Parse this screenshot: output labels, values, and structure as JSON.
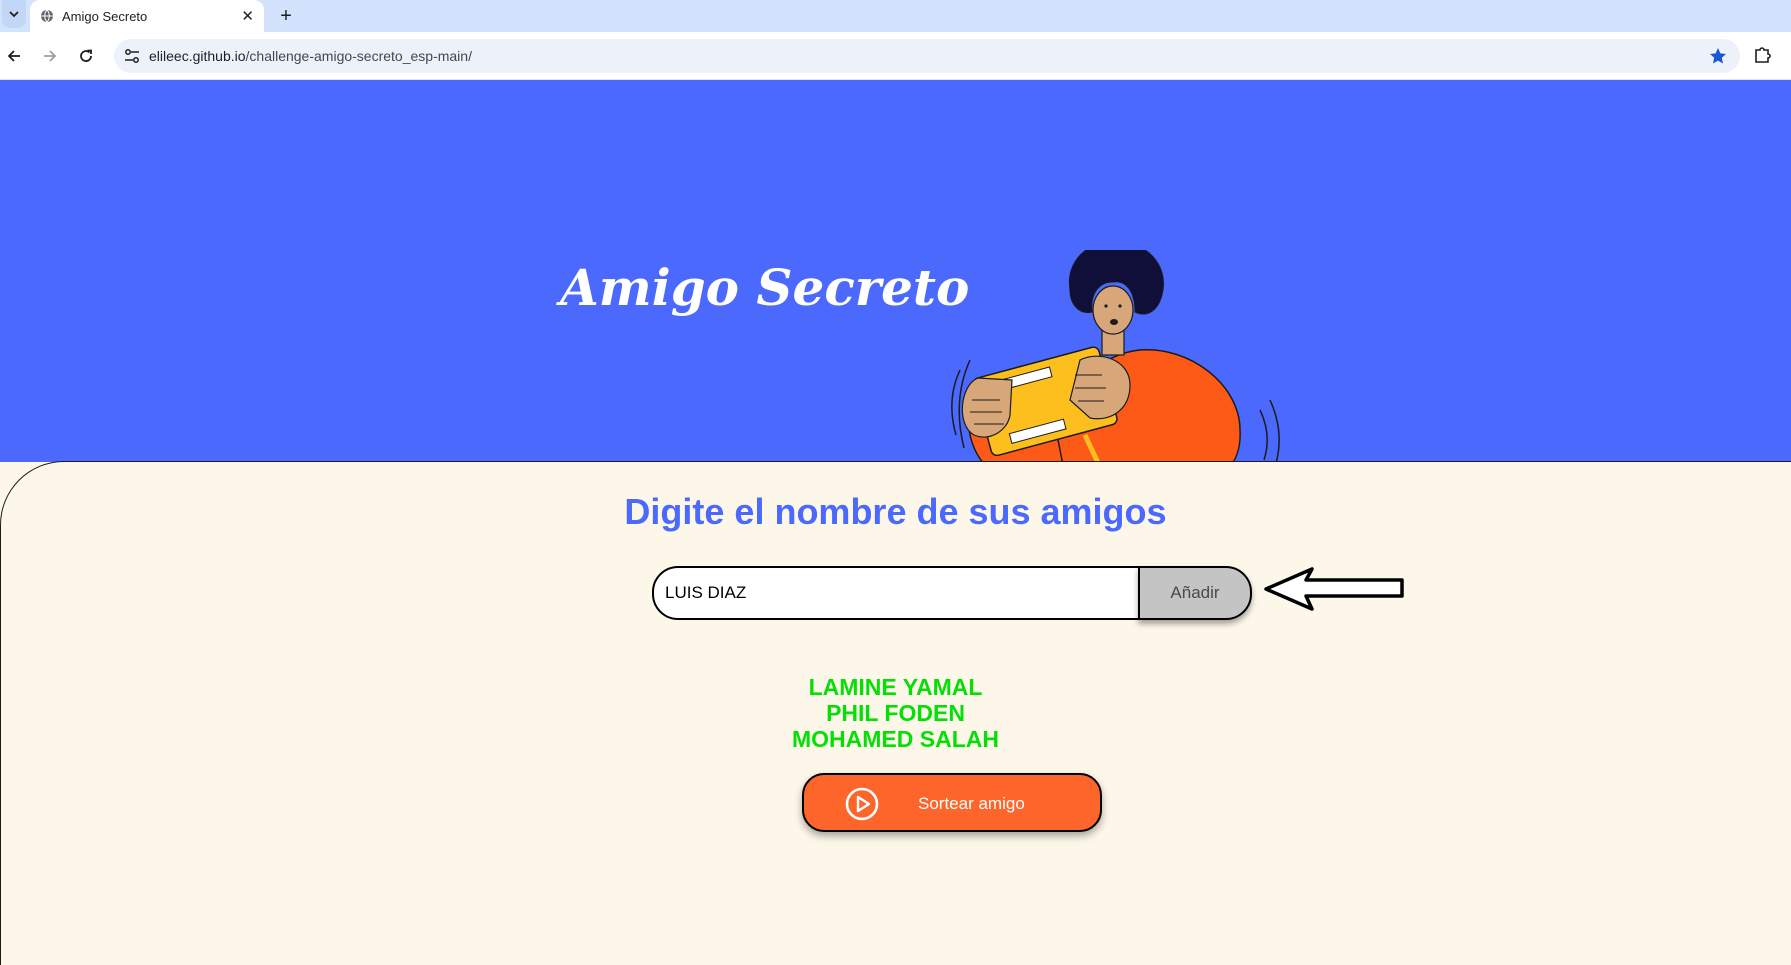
{
  "browser": {
    "tab_title": "Amigo Secreto",
    "url_host": "elileec.github.io",
    "url_path": "/challenge-amigo-secreto_esp-main/"
  },
  "hero": {
    "title": "Amigo Secreto"
  },
  "main": {
    "headline": "Digite el nombre de sus amigos",
    "input_value": "LUIS DIAZ",
    "add_button_label": "Añadir",
    "friends": [
      "LAMINE YAMAL",
      "PHIL FODEN",
      "MOHAMED SALAH"
    ],
    "draw_button_label": "Sortear amigo"
  },
  "colors": {
    "hero_bg": "#4b69fd",
    "page_bg": "#fdf7ea",
    "headline": "#4b69fd",
    "friend_text": "#05df05",
    "draw_button_bg": "#fe652b",
    "add_button_bg": "#c4c4c4"
  },
  "icons": {
    "tab_favicon": "globe-icon",
    "back": "arrow-left-icon",
    "forward": "arrow-right-icon",
    "reload": "reload-icon",
    "site_info": "tune-icon",
    "bookmark": "star-icon",
    "extensions": "puzzle-icon",
    "draw": "play-circle-icon",
    "annotation": "hollow-arrow-left-icon"
  }
}
